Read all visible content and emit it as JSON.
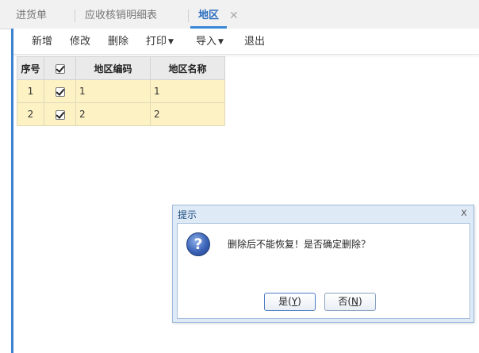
{
  "tabs": {
    "items": [
      {
        "label": "进货单"
      },
      {
        "label": "应收核销明细表"
      },
      {
        "label": "地区"
      }
    ],
    "close_glyph": "✕"
  },
  "toolbar": {
    "new_label": "新增",
    "edit_label": "修改",
    "delete_label": "删除",
    "print_label": "打印",
    "import_label": "导入",
    "exit_label": "退出"
  },
  "grid": {
    "headers": {
      "index": "序号",
      "code": "地区编码",
      "name": "地区名称"
    },
    "rows": [
      {
        "index": "1",
        "checked": true,
        "code": "1",
        "name": "1"
      },
      {
        "index": "2",
        "checked": true,
        "code": "2",
        "name": "2"
      }
    ]
  },
  "dialog": {
    "title": "提示",
    "close_glyph": "x",
    "message": "删除后不能恢复！是否确定删除？",
    "yes": {
      "label": "是",
      "hotkey": "Y"
    },
    "no": {
      "label": "否",
      "hotkey": "N"
    }
  },
  "colors": {
    "accent": "#3a86d6",
    "row_highlight": "#fdf2c4",
    "dialog_bg": "#dfeaf7"
  }
}
